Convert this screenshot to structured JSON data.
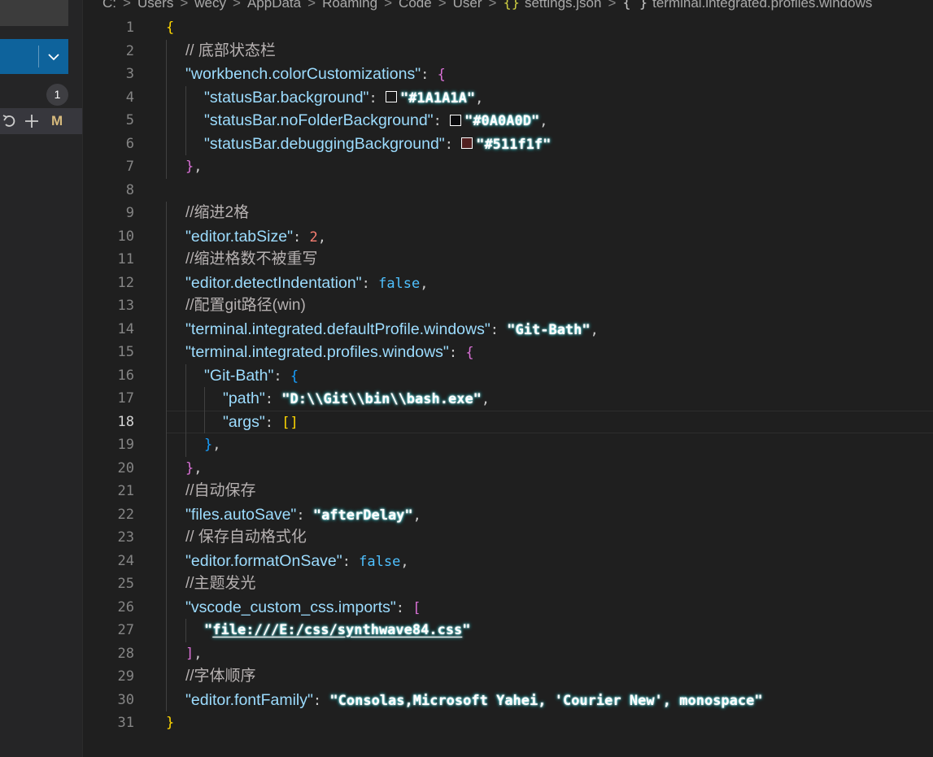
{
  "sidebar": {
    "badge": "1",
    "change_mark": "M"
  },
  "breadcrumb": {
    "items": [
      "C:",
      "Users",
      "wecy",
      "AppData",
      "Roaming",
      "Code",
      "User",
      "settings.json",
      "terminal.integrated.profiles.windows"
    ],
    "json_icon": "{}",
    "obj_icon": "{ }"
  },
  "editor": {
    "current_line": 18,
    "lines": [
      {
        "n": "1",
        "indent": 0,
        "tokens": [
          [
            "brace",
            "{"
          ]
        ]
      },
      {
        "n": "2",
        "indent": 1,
        "tokens": [
          [
            "comment",
            "// 底部状态栏"
          ]
        ]
      },
      {
        "n": "3",
        "indent": 1,
        "tokens": [
          [
            "key",
            "\"workbench.colorCustomizations\""
          ],
          [
            "punct",
            ": "
          ],
          [
            "brace2",
            "{"
          ]
        ]
      },
      {
        "n": "4",
        "indent": 2,
        "tokens": [
          [
            "key",
            "\"statusBar.background\""
          ],
          [
            "punct",
            ": "
          ],
          [
            "swatch",
            "#1A1A1A"
          ],
          [
            "str",
            "\"#1A1A1A\""
          ],
          [
            "punct",
            ","
          ]
        ]
      },
      {
        "n": "5",
        "indent": 2,
        "tokens": [
          [
            "key",
            "\"statusBar.noFolderBackground\""
          ],
          [
            "punct",
            ": "
          ],
          [
            "swatch",
            "#0A0A0D"
          ],
          [
            "str",
            "\"#0A0A0D\""
          ],
          [
            "punct",
            ","
          ]
        ]
      },
      {
        "n": "6",
        "indent": 2,
        "tokens": [
          [
            "key",
            "\"statusBar.debuggingBackground\""
          ],
          [
            "punct",
            ": "
          ],
          [
            "swatch",
            "#511f1f"
          ],
          [
            "str",
            "\"#511f1f\""
          ]
        ]
      },
      {
        "n": "7",
        "indent": 1,
        "tokens": [
          [
            "brace2",
            "}"
          ],
          [
            "punct",
            ","
          ]
        ]
      },
      {
        "n": "8",
        "indent": 0,
        "tokens": []
      },
      {
        "n": "9",
        "indent": 1,
        "tokens": [
          [
            "comment",
            "//缩进2格"
          ]
        ]
      },
      {
        "n": "10",
        "indent": 1,
        "tokens": [
          [
            "key",
            "\"editor.tabSize\""
          ],
          [
            "punct",
            ": "
          ],
          [
            "num",
            "2"
          ],
          [
            "punct",
            ","
          ]
        ]
      },
      {
        "n": "11",
        "indent": 1,
        "tokens": [
          [
            "comment",
            "//缩进格数不被重写"
          ]
        ]
      },
      {
        "n": "12",
        "indent": 1,
        "tokens": [
          [
            "key",
            "\"editor.detectIndentation\""
          ],
          [
            "punct",
            ": "
          ],
          [
            "bool",
            "false"
          ],
          [
            "punct",
            ","
          ]
        ]
      },
      {
        "n": "13",
        "indent": 1,
        "tokens": [
          [
            "comment",
            "//配置git路径(win)"
          ]
        ]
      },
      {
        "n": "14",
        "indent": 1,
        "tokens": [
          [
            "key",
            "\"terminal.integrated.defaultProfile.windows\""
          ],
          [
            "punct",
            ": "
          ],
          [
            "str",
            "\"Git-Bath\""
          ],
          [
            "punct",
            ","
          ]
        ]
      },
      {
        "n": "15",
        "indent": 1,
        "tokens": [
          [
            "key",
            "\"terminal.integrated.profiles.windows\""
          ],
          [
            "punct",
            ": "
          ],
          [
            "brace2",
            "{"
          ]
        ]
      },
      {
        "n": "16",
        "indent": 2,
        "tokens": [
          [
            "key",
            "\"Git-Bath\""
          ],
          [
            "punct",
            ": "
          ],
          [
            "brace3",
            "{"
          ]
        ]
      },
      {
        "n": "17",
        "indent": 3,
        "tokens": [
          [
            "key",
            "\"path\""
          ],
          [
            "punct",
            ": "
          ],
          [
            "str",
            "\"D:\\\\Git\\\\bin\\\\bash.exe\""
          ],
          [
            "punct",
            ","
          ]
        ]
      },
      {
        "n": "18",
        "indent": 3,
        "tokens": [
          [
            "key",
            "\"args\""
          ],
          [
            "punct",
            ": "
          ],
          [
            "brace",
            "[]"
          ]
        ]
      },
      {
        "n": "19",
        "indent": 2,
        "tokens": [
          [
            "brace3",
            "}"
          ],
          [
            "punct",
            ","
          ]
        ]
      },
      {
        "n": "20",
        "indent": 1,
        "tokens": [
          [
            "brace2",
            "}"
          ],
          [
            "punct",
            ","
          ]
        ]
      },
      {
        "n": "21",
        "indent": 1,
        "tokens": [
          [
            "comment",
            "//自动保存"
          ]
        ]
      },
      {
        "n": "22",
        "indent": 1,
        "tokens": [
          [
            "key",
            "\"files.autoSave\""
          ],
          [
            "punct",
            ": "
          ],
          [
            "str",
            "\"afterDelay\""
          ],
          [
            "punct",
            ","
          ]
        ]
      },
      {
        "n": "23",
        "indent": 1,
        "tokens": [
          [
            "comment",
            "// 保存自动格式化"
          ]
        ]
      },
      {
        "n": "24",
        "indent": 1,
        "tokens": [
          [
            "key",
            "\"editor.formatOnSave\""
          ],
          [
            "punct",
            ": "
          ],
          [
            "bool",
            "false"
          ],
          [
            "punct",
            ","
          ]
        ]
      },
      {
        "n": "25",
        "indent": 1,
        "tokens": [
          [
            "comment",
            "//主题发光"
          ]
        ]
      },
      {
        "n": "26",
        "indent": 1,
        "tokens": [
          [
            "key",
            "\"vscode_custom_css.imports\""
          ],
          [
            "punct",
            ": "
          ],
          [
            "brace2",
            "["
          ]
        ]
      },
      {
        "n": "27",
        "indent": 2,
        "tokens": [
          [
            "str",
            "\""
          ],
          [
            "url",
            "file:///E:/css/synthwave84.css"
          ],
          [
            "str",
            "\""
          ]
        ]
      },
      {
        "n": "28",
        "indent": 1,
        "tokens": [
          [
            "brace2",
            "]"
          ],
          [
            "punct",
            ","
          ]
        ]
      },
      {
        "n": "29",
        "indent": 1,
        "tokens": [
          [
            "comment",
            "//字体顺序"
          ]
        ]
      },
      {
        "n": "30",
        "indent": 1,
        "tokens": [
          [
            "key",
            "\"editor.fontFamily\""
          ],
          [
            "punct",
            ": "
          ],
          [
            "str",
            "\"Consolas,Microsoft Yahei, 'Courier New', monospace\""
          ]
        ]
      },
      {
        "n": "31",
        "indent": 0,
        "tokens": [
          [
            "brace",
            "}"
          ]
        ]
      }
    ]
  }
}
